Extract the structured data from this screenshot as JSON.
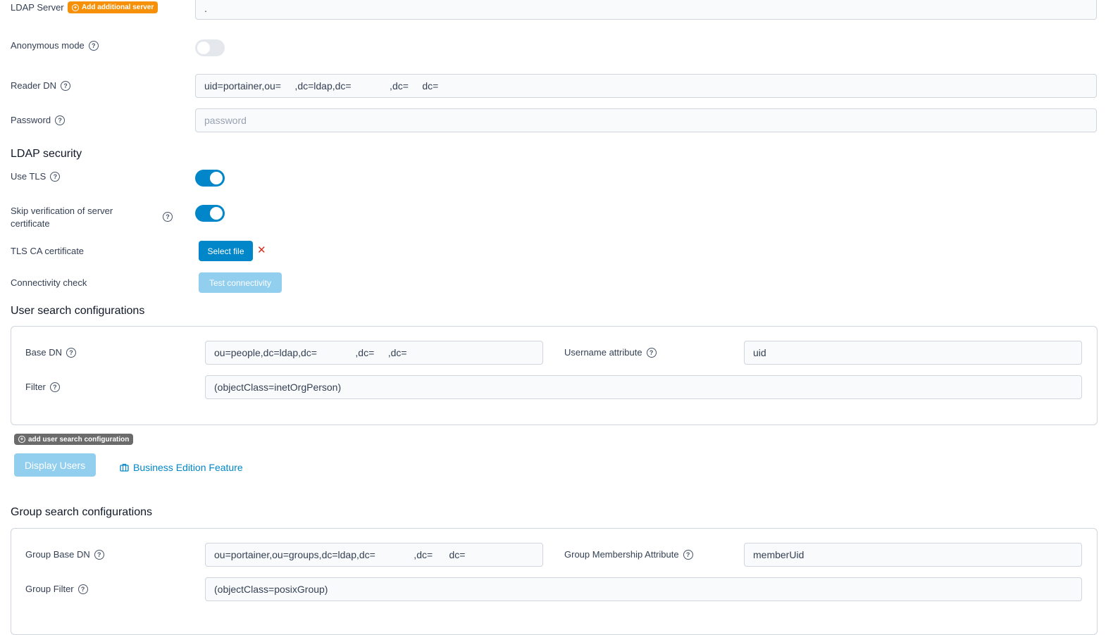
{
  "ldap_server": {
    "label": "LDAP Server",
    "add_button": "Add additional server",
    "value": ".",
    "colors": {
      "badge": "#f79009"
    }
  },
  "anonymous_mode": {
    "label": "Anonymous mode",
    "enabled": false
  },
  "reader_dn": {
    "label": "Reader DN",
    "value": "uid=portainer,ou=     ,dc=ldap,dc=              ,dc=     dc="
  },
  "password": {
    "label": "Password",
    "placeholder": "password"
  },
  "ldap_security": {
    "title": "LDAP security",
    "use_tls": {
      "label": "Use TLS",
      "enabled": true
    },
    "skip_verification": {
      "label": "Skip verification of server certificate",
      "enabled": true
    },
    "tls_ca": {
      "label": "TLS CA certificate",
      "select_file": "Select file",
      "remove_icon": "close-icon"
    },
    "connectivity": {
      "label": "Connectivity check",
      "button": "Test connectivity"
    }
  },
  "user_search": {
    "title": "User search configurations",
    "base_dn": {
      "label": "Base DN",
      "value": "ou=people,dc=ldap,dc=              ,dc=     ,dc="
    },
    "username_attribute": {
      "label": "Username attribute",
      "value": "uid"
    },
    "filter": {
      "label": "Filter",
      "value": "(objectClass=inetOrgPerson)"
    },
    "add_config": "add user search configuration",
    "display_users": "Display Users",
    "business_feature": "Business Edition Feature"
  },
  "group_search": {
    "title": "Group search configurations",
    "base_dn": {
      "label": "Group Base DN",
      "value": "ou=portainer,ou=groups,dc=ldap,dc=              ,dc=      dc="
    },
    "membership_attribute": {
      "label": "Group Membership Attribute",
      "value": "memberUid"
    },
    "filter": {
      "label": "Group Filter",
      "value": "(objectClass=posixGroup)"
    }
  },
  "colors": {
    "primary": "#0086c9",
    "disabled": "#92cfee",
    "danger": "#d92d20",
    "badge_gray": "#6b6b6b"
  }
}
